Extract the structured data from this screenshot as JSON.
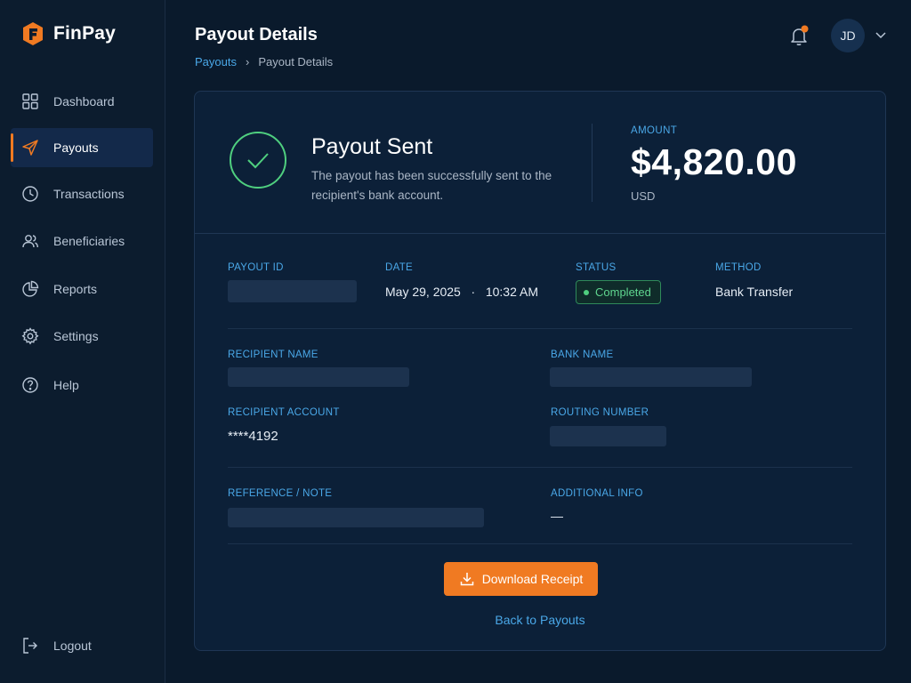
{
  "app": {
    "name": "FinPay"
  },
  "sidebar": {
    "items": [
      {
        "label": "Dashboard",
        "icon": "grid-icon"
      },
      {
        "label": "Payouts",
        "icon": "send-icon",
        "active": true
      },
      {
        "label": "Transactions",
        "icon": "clock-icon"
      },
      {
        "label": "Beneficiaries",
        "icon": "users-icon"
      },
      {
        "label": "Reports",
        "icon": "pie-chart-icon"
      },
      {
        "label": "Settings",
        "icon": "gear-icon"
      },
      {
        "label": "Help",
        "icon": "help-circle-icon"
      }
    ],
    "logout": {
      "label": "Logout",
      "icon": "logout-icon"
    }
  },
  "header": {
    "title": "Payout Details",
    "breadcrumb": {
      "parent": "Payouts",
      "separator": "›",
      "current": "Payout Details"
    },
    "user_initials": "JD",
    "notification_dot": true
  },
  "summary": {
    "title": "Payout Sent",
    "description": "The payout has been successfully sent to the recipient's bank account.",
    "amount_label": "AMOUNT",
    "amount": "$4,820.00",
    "currency": "USD"
  },
  "details": {
    "payout_id": {
      "label": "PAYOUT ID",
      "value": null,
      "redacted": true
    },
    "date": {
      "label": "DATE",
      "value": "May 29, 2025   ·   10:32 AM"
    },
    "status": {
      "label": "STATUS",
      "value": "Completed"
    },
    "method": {
      "label": "METHOD",
      "value": "Bank Transfer"
    },
    "recipient_name": {
      "label": "RECIPIENT NAME",
      "value": null,
      "redacted": true
    },
    "bank_name": {
      "label": "BANK NAME",
      "value": null,
      "redacted": true
    },
    "recipient_account": {
      "label": "RECIPIENT ACCOUNT",
      "value": "****4192"
    },
    "routing_number": {
      "label": "ROUTING NUMBER",
      "value": null,
      "redacted": true
    },
    "reference": {
      "label": "REFERENCE / NOTE",
      "value": null,
      "redacted": true
    },
    "additional_info": {
      "label": "ADDITIONAL INFO",
      "value": "—"
    }
  },
  "actions": {
    "download_label": "Download Receipt",
    "back_label": "Back to Payouts"
  },
  "colors": {
    "accent": "#f07a22",
    "link": "#4aa8e8",
    "success": "#5fd68f",
    "background": "#0a1a2c",
    "card": "#0c2038"
  }
}
